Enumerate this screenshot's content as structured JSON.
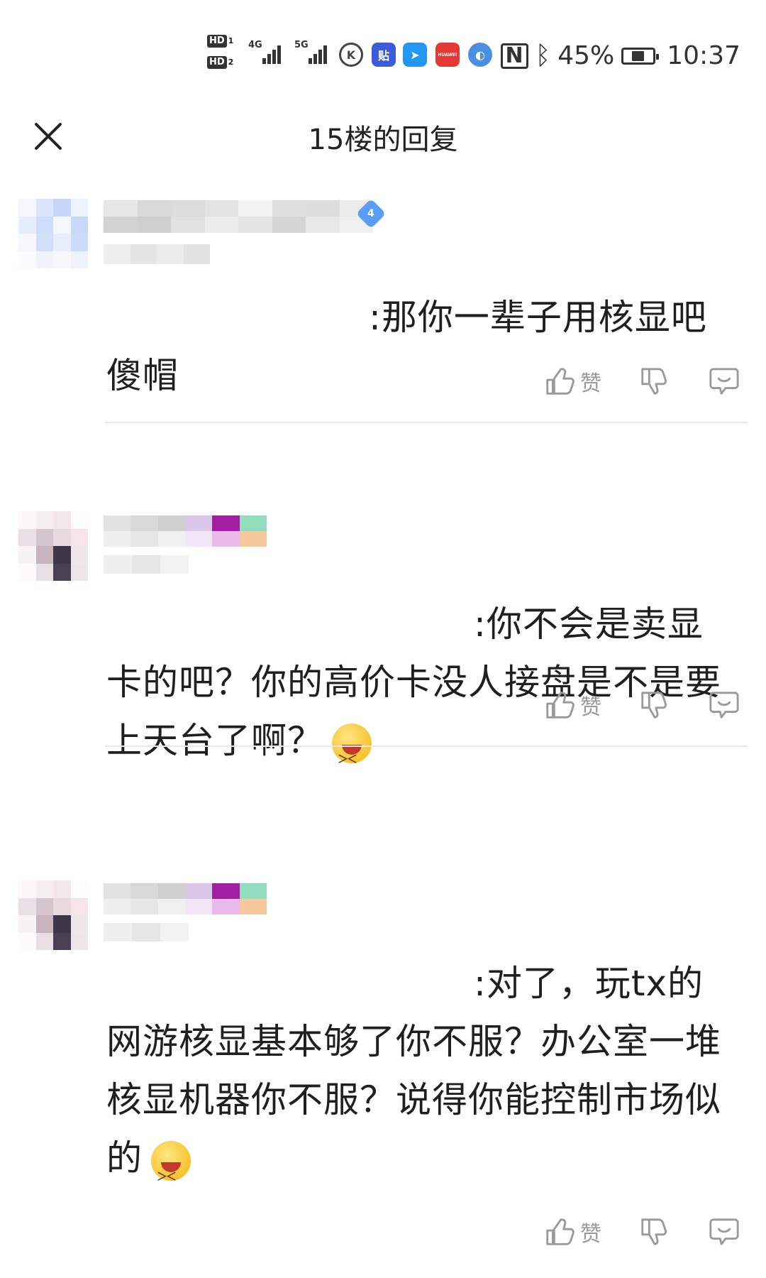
{
  "status_bar": {
    "hd1": "HD",
    "hd1_sim": "1",
    "hd2": "HD",
    "hd2_sim": "2",
    "net1": "4G",
    "net2": "5G",
    "battery_pct_text": "45%",
    "battery_level": 0.45,
    "time": "10:37",
    "app_icons": [
      "k-app-icon",
      "tieba-icon",
      "dingtalk-icon",
      "huawei-appgallery-icon",
      "browser-icon"
    ],
    "tieba_label": "贴",
    "k_label": "K",
    "huawei_label": "HUAWEI"
  },
  "header": {
    "title": "15楼的回复"
  },
  "replies": [
    {
      "text": ":那你一辈子用核显吧傻帽",
      "level_badge": "4",
      "like_label": "赞"
    },
    {
      "text": ":你不会是卖显卡的吧？你的高价卡没人接盘是不是要上天台了啊？",
      "emoji": "grinning-squint-emoji",
      "like_label": "赞"
    },
    {
      "text": ":对了，玩tx的网游核显基本够了你不服？办公室一堆核显机器你不服？说得你能控制市场似的",
      "emoji": "grinning-squint-emoji",
      "like_label": "赞"
    }
  ],
  "colors": {
    "icon_gray": "#9a9a9a",
    "divider": "#e8e8e8",
    "badge_blue": "#5b9cf5"
  }
}
